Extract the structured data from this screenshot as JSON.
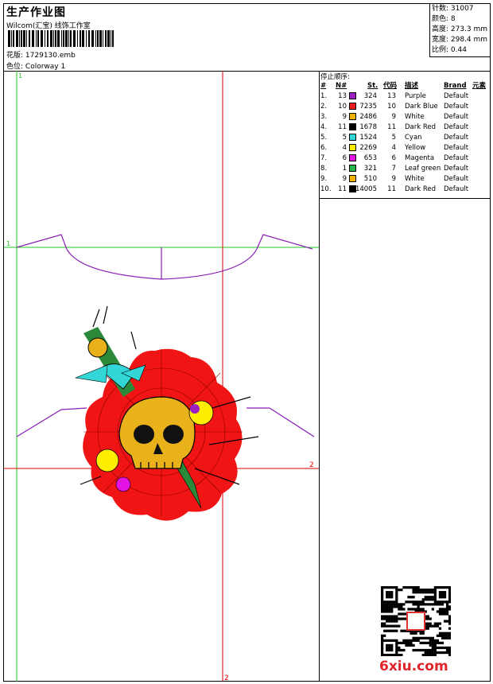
{
  "header": {
    "title": "生产作业图",
    "company": "Wilcom(汇宝) 线饰工作室",
    "design_label": "花版:",
    "design_value": "1729130.emb",
    "colorway_label": "色位:",
    "colorway_value": "Colorway 1"
  },
  "stats": {
    "stitches": "针数: 31007",
    "colors": "颜色: 8",
    "height": "高度: 273.3 mm",
    "width": "宽度: 298.4 mm",
    "scale": "比例: 0.44"
  },
  "stop_sequence": {
    "heading": "停止顺序:",
    "columns": [
      "#",
      "N#",
      "St.",
      "代码",
      "描述",
      "Brand",
      "元素"
    ],
    "rows": [
      {
        "idx": "1.",
        "n": "13",
        "color": "#9b1fc1",
        "st": "324",
        "code": "13",
        "desc": "Purple",
        "brand": "Default"
      },
      {
        "idx": "2.",
        "n": "10",
        "color": "#ee1c1c",
        "st": "7235",
        "code": "10",
        "desc": "Dark Blue",
        "brand": "Default"
      },
      {
        "idx": "3.",
        "n": "9",
        "color": "#f2b200",
        "st": "2486",
        "code": "9",
        "desc": "White",
        "brand": "Default"
      },
      {
        "idx": "4.",
        "n": "11",
        "color": "#000000",
        "st": "1678",
        "code": "11",
        "desc": "Dark Red",
        "brand": "Default"
      },
      {
        "idx": "5.",
        "n": "5",
        "color": "#33d6d6",
        "st": "1524",
        "code": "5",
        "desc": "Cyan",
        "brand": "Default"
      },
      {
        "idx": "6.",
        "n": "4",
        "color": "#ffee00",
        "st": "2269",
        "code": "4",
        "desc": "Yellow",
        "brand": "Default"
      },
      {
        "idx": "7.",
        "n": "6",
        "color": "#e312e3",
        "st": "653",
        "code": "6",
        "desc": "Magenta",
        "brand": "Default"
      },
      {
        "idx": "8.",
        "n": "1",
        "color": "#28b44a",
        "st": "321",
        "code": "7",
        "desc": "Leaf green",
        "brand": "Default"
      },
      {
        "idx": "9.",
        "n": "9",
        "color": "#f2b200",
        "st": "510",
        "code": "9",
        "desc": "White",
        "brand": "Default"
      },
      {
        "idx": "10.",
        "n": "11",
        "color": "#000000",
        "st": "14005",
        "code": "11",
        "desc": "Dark Red",
        "brand": "Default"
      }
    ]
  },
  "canvas": {
    "green_guide_1": "1",
    "green_guide_1b": "1",
    "red_guide_2": "2",
    "red_guide_2b": "2"
  },
  "watermark": {
    "site": "6xiu.com"
  },
  "colors": {
    "green_guide": "#22c922",
    "red_guide": "#e00000",
    "neckline": "#8a1fb5",
    "fill_red": "#f01414",
    "skull": "#e9b21a"
  }
}
